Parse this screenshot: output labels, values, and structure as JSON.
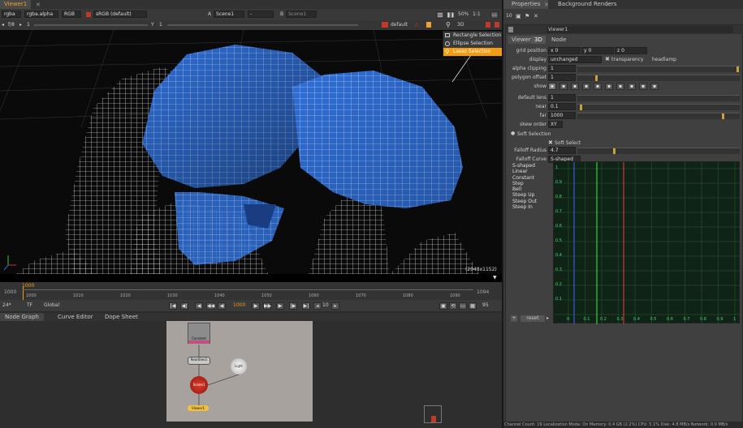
{
  "viewer": {
    "tab_label": "Viewer1",
    "channels": "rgba",
    "alpha": "rgba.alpha",
    "colorspace_mode": "RGB",
    "lut": "sRGB (default)",
    "input_a_label": "A",
    "input_a": "Scene1",
    "blend_mode": "-",
    "input_b_label": "B",
    "input_b": "Scene1",
    "zoom": "50%",
    "ratio": "1:1",
    "fstop": "f/8",
    "gain": "1",
    "gamma_label": "Y",
    "gamma": "1",
    "camera": "default",
    "view_mode": "3D",
    "resolution_label": "(2048x1152)"
  },
  "selection_menu": {
    "items": [
      "Rectangle Selection",
      "Ellipse Selection",
      "Lasso Selection"
    ],
    "selected": "Lasso Selection"
  },
  "timeline": {
    "start": "1000",
    "end": "1094",
    "ticks": [
      "1000",
      "1010",
      "1020",
      "1030",
      "1040",
      "1050",
      "1060",
      "1070",
      "1080",
      "1090"
    ],
    "current_marker": "1000",
    "fps": "24*",
    "tf": "TF",
    "scope": "Global",
    "current_frame": "1000",
    "step": "10",
    "out_frame": "95"
  },
  "bottom_tabs": [
    "Node Graph",
    "Curve Editor",
    "Dope Sheet"
  ],
  "nodes": {
    "constant": "Constant",
    "readgeo": "ReadGeo1",
    "light": "Light",
    "scene": "Scene1",
    "viewer": "Viewer1"
  },
  "properties": {
    "tabs": [
      "Properties",
      "Background Renders"
    ],
    "count": "10",
    "node_name": "Viewer1",
    "subtabs": [
      "Viewer",
      "3D",
      "Node"
    ],
    "grid_position_label": "grid position",
    "grid_x_label": "x",
    "grid_x": "0",
    "grid_y_label": "y",
    "grid_y": "0",
    "grid_z_label": "z",
    "grid_z": "0",
    "display_label": "display",
    "display_value": "unchanged",
    "transparency_label": "transparency",
    "headlamp_label": "headlamp",
    "alpha_clipping_label": "alpha clipping",
    "alpha_clipping": "1",
    "polygon_offset_label": "polygon offset",
    "polygon_offset": "1",
    "show_label": "show",
    "default_lens_label": "default lens",
    "default_lens": "1",
    "near_label": "near",
    "near": "0.1",
    "far_label": "far",
    "far": "1000",
    "skew_order_label": "skew order",
    "skew_order": "XY",
    "soft_selection_header": "Soft Selection",
    "soft_select_label": "Soft Select",
    "falloff_radius_label": "Falloff Radius",
    "falloff_radius": "4.7",
    "falloff_curve_label": "Falloff Curve",
    "falloff_curve": "S-shaped",
    "curve_types": [
      "S-shaped",
      "Linear",
      "Constant",
      "Step",
      "Bell",
      "Steep Up",
      "Steep Out",
      "Steep In"
    ],
    "graph_y_labels": [
      "1",
      "0.9",
      "0.8",
      "0.7",
      "0.6",
      "0.5",
      "0.4",
      "0.3",
      "0.2",
      "0.1"
    ],
    "graph_x_labels": [
      "0",
      "0.1",
      "0.2",
      "0.3",
      "0.4",
      "0.5",
      "0.6",
      "0.7",
      "0.8",
      "0.9",
      "1"
    ],
    "reset_label": "reset",
    "add_label": "+"
  },
  "status_bar": "Channel Count: 19  Localization Mode: On  Memory: 0.4 GB (2.2%)  CPU: 5.1%  Disk: 4.8 MB/s  Network: 0.0 MB/s",
  "colors": {
    "accent": "#f39c12",
    "wire_blue": "#3b7ee8",
    "graph_bg": "#0f2416"
  }
}
